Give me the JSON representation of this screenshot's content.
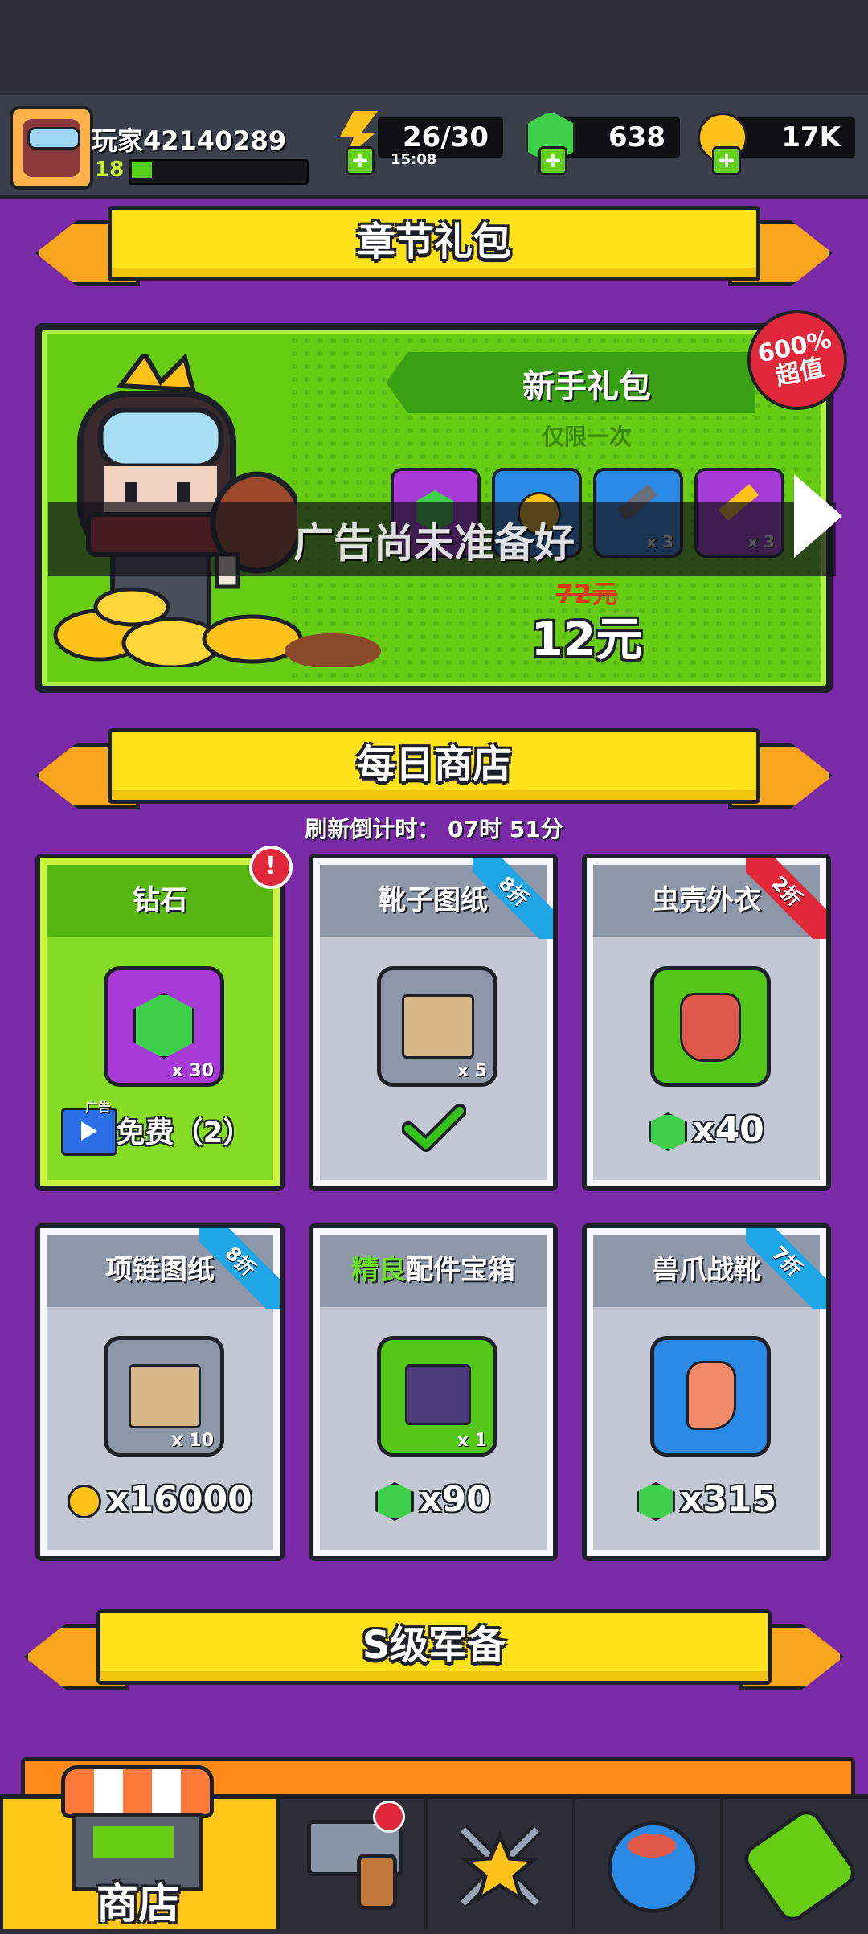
{
  "player": {
    "name": "玩家42140289",
    "level": "18",
    "xp_fraction": 0.12
  },
  "resources": {
    "energy": "26/30",
    "energy_timer": "15:08",
    "gems": "638",
    "coins": "17K"
  },
  "chapter_pack": {
    "banner_title": "章节礼包",
    "pack_title": "新手礼包",
    "pack_subtitle": "仅限一次",
    "value_badge": "600%\n超值",
    "ad_overlay": "广告尚未准备好",
    "old_price": "72元",
    "new_price": "12元",
    "items": [
      {
        "icon": "gem-icon",
        "count": ""
      },
      {
        "icon": "coin-icon",
        "count": ""
      },
      {
        "icon": "key-icon",
        "count": "x 3"
      },
      {
        "icon": "golden-key-icon",
        "count": "x 3"
      }
    ]
  },
  "daily_shop": {
    "banner_title": "每日商店",
    "refresh_label": "刷新倒计时：  07时 51分",
    "cards": [
      {
        "title": "钻石",
        "qty": "x 30",
        "price": "免费（2）",
        "ad_tag": "广告",
        "ribbon": "",
        "icon": "gem-icon",
        "status": "free-ad"
      },
      {
        "title": "靴子图纸",
        "qty": "x 5",
        "price": "",
        "ribbon": "8折",
        "icon": "blueprint-icon",
        "status": "purchased"
      },
      {
        "title": "虫壳外衣",
        "qty": "",
        "price": "x40",
        "ribbon": "2折",
        "icon": "armor-icon",
        "status": "gem"
      },
      {
        "title": "项链图纸",
        "qty": "x 10",
        "price": "x16000",
        "ribbon": "8折",
        "icon": "blueprint-icon",
        "status": "coin"
      },
      {
        "title_prefix": "精良",
        "title": "配件宝箱",
        "qty": "x 1",
        "price": "x90",
        "ribbon": "",
        "icon": "chest-icon",
        "status": "gem"
      },
      {
        "title": "兽爪战靴",
        "qty": "",
        "price": "x315",
        "ribbon": "7折",
        "icon": "boots-icon",
        "status": "gem"
      }
    ]
  },
  "s_gear": {
    "banner_title": "S级军备"
  },
  "bottom_nav": {
    "active_label": "商店"
  },
  "colors": {
    "background": "#7a2aa6",
    "banner": "#ffe21a",
    "green": "#66cc14",
    "ribbon_blue": "#1fa6e6",
    "ribbon_red": "#e0283a"
  }
}
